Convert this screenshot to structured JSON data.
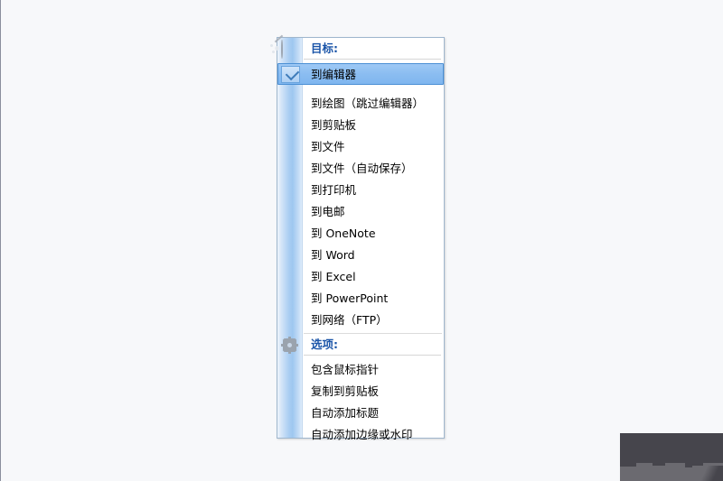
{
  "menu": {
    "sections": [
      {
        "id": "target",
        "header": "目标:",
        "header_icon": "palette-icon",
        "items": [
          {
            "label": "到编辑器",
            "checked": true
          },
          {
            "label": "到绘图（跳过编辑器）",
            "checked": false
          },
          {
            "label": "到剪贴板",
            "checked": false
          },
          {
            "label": "到文件",
            "checked": false
          },
          {
            "label": "到文件（自动保存）",
            "checked": false
          },
          {
            "label": "到打印机",
            "checked": false
          },
          {
            "label": "到电邮",
            "checked": false
          },
          {
            "label": "到 OneNote",
            "checked": false
          },
          {
            "label": "到 Word",
            "checked": false
          },
          {
            "label": "到 Excel",
            "checked": false
          },
          {
            "label": "到 PowerPoint",
            "checked": false
          },
          {
            "label": "到网络（FTP）",
            "checked": false
          }
        ]
      },
      {
        "id": "options",
        "header": "选项:",
        "header_icon": "gear-icon",
        "items": [
          {
            "label": "包含鼠标指针",
            "checked": false
          },
          {
            "label": "复制到剪贴板",
            "checked": false
          },
          {
            "label": "自动添加标题",
            "checked": false
          },
          {
            "label": "自动添加边缘或水印",
            "checked": false
          }
        ]
      }
    ]
  },
  "colors": {
    "page_background": "#f7f8fa",
    "menu_background": "#ffffff",
    "menu_border": "#9fb6cd",
    "gutter_blue": "#a9cdf2",
    "selection_blue": "#8bbdf1",
    "selection_border": "#4a8fd4",
    "header_text": "#1a54a8",
    "item_text": "#000000",
    "corner_shape_dark": "#46454c",
    "corner_shape_mid": "#6b6a70",
    "left_rule": "#8a8f9c"
  }
}
